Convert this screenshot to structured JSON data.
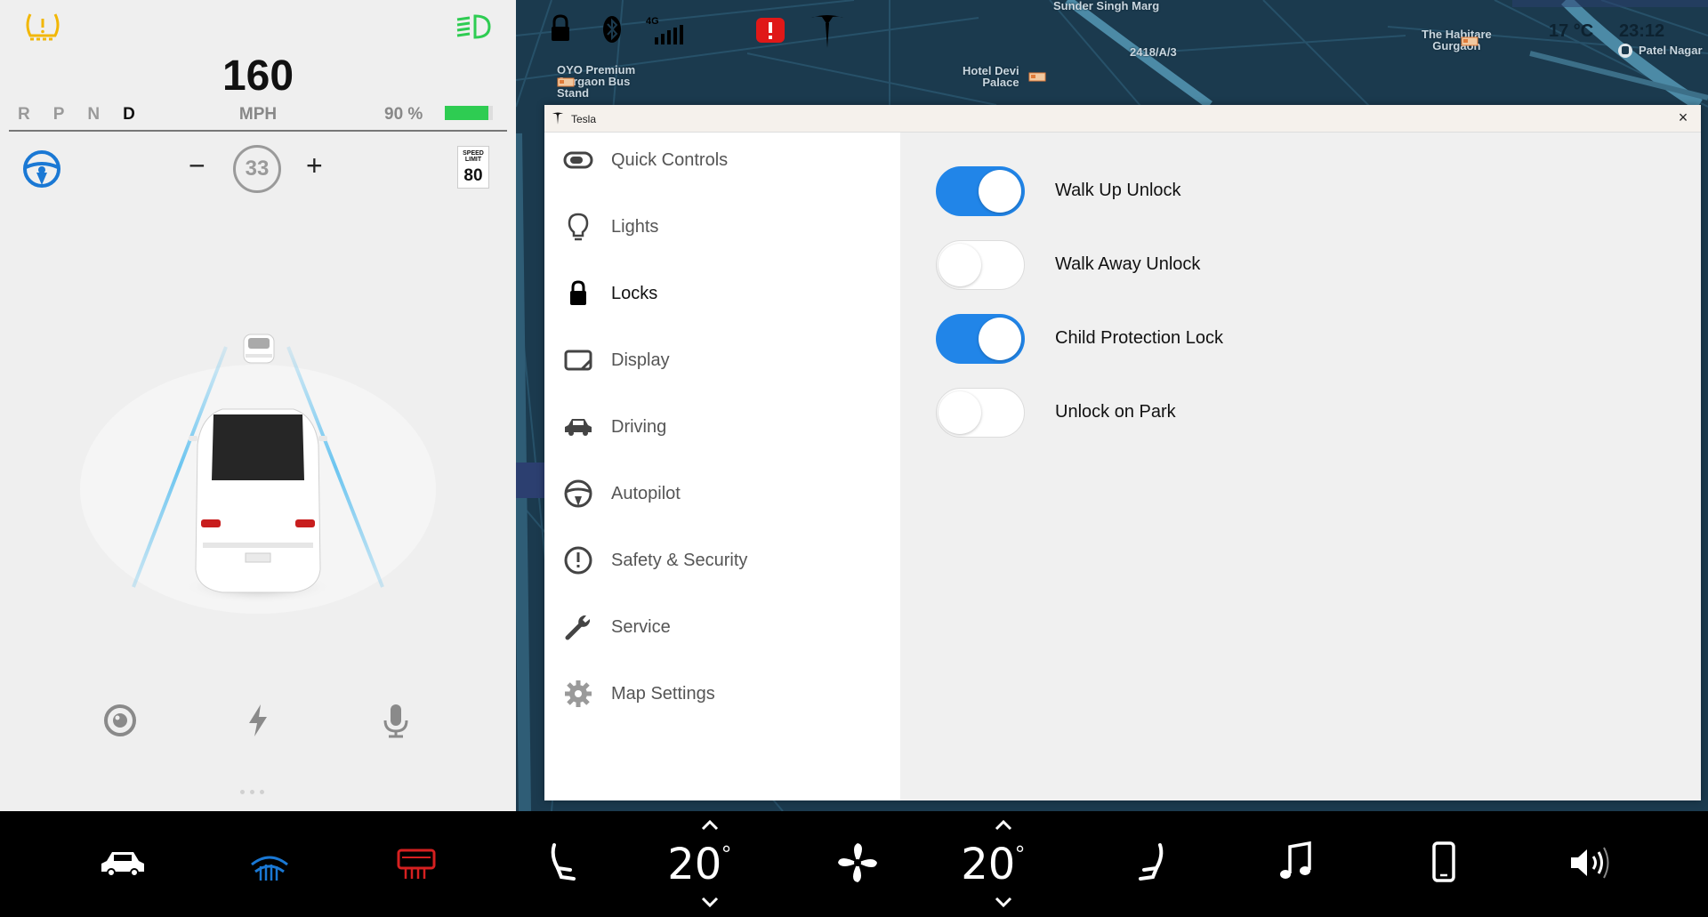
{
  "driver_panel": {
    "speed": "160",
    "speed_unit": "MPH",
    "gears": [
      "R",
      "P",
      "N",
      "D"
    ],
    "active_gear": "D",
    "battery_percent_label": "90 %",
    "battery_level": 0.9,
    "cruise_minus": "−",
    "cruise_speed": "33",
    "cruise_plus": "+",
    "speed_limit_title": "SPEED LIMIT",
    "speed_limit_value": "80",
    "bottom_icons": [
      "camera-icon",
      "bolt-icon",
      "microphone-icon"
    ],
    "colors": {
      "warning": "#f2b705",
      "headlight": "#2ecc52",
      "steering": "#1a78d4",
      "battery": "#2ecc52"
    }
  },
  "map": {
    "labels": {
      "sunder_singh_marg": "Sunder Singh Marg",
      "plot_2418": "2418/A/3",
      "habitare_1": "The Habitare",
      "habitare_2": "Gurgaon",
      "oyo_1": "OYO Premium",
      "oyo_2": "Gurgaon Bus",
      "oyo_3": "Stand",
      "devi_1": "Hotel Devi",
      "devi_2": "Palace",
      "patel_nagar": "Patel Nagar"
    },
    "temperature": "17 °C",
    "time": "23:12",
    "status_icons": [
      "lock-icon",
      "bluetooth-icon",
      "signal-4g-icon",
      "alert-icon",
      "tesla-logo-icon"
    ],
    "network_label": "4G"
  },
  "settings_window": {
    "title": "Tesla",
    "close_label": "×",
    "nav_items": [
      {
        "label": "Quick Controls",
        "icon": "toggle-icon"
      },
      {
        "label": "Lights",
        "icon": "bulb-icon"
      },
      {
        "label": "Locks",
        "icon": "lock-icon"
      },
      {
        "label": "Display",
        "icon": "display-icon"
      },
      {
        "label": "Driving",
        "icon": "car-icon"
      },
      {
        "label": "Autopilot",
        "icon": "steering-wheel-icon"
      },
      {
        "label": "Safety & Security",
        "icon": "alert-circle-icon"
      },
      {
        "label": "Service",
        "icon": "wrench-icon"
      },
      {
        "label": "Map Settings",
        "icon": "gear-icon"
      }
    ],
    "active_nav": "Locks",
    "toggles": [
      {
        "label": "Walk Up Unlock",
        "on": true
      },
      {
        "label": "Walk Away Unlock",
        "on": false
      },
      {
        "label": "Child Protection Lock",
        "on": true
      },
      {
        "label": "Unlock on Park",
        "on": false
      }
    ],
    "colors": {
      "toggle_on": "#2185e8"
    }
  },
  "bottom_bar": {
    "icons": [
      "car-icon",
      "front-defrost-icon",
      "rear-defrost-icon",
      "seat-heater-left-icon",
      "fan-icon",
      "seat-heater-right-icon",
      "music-icon",
      "phone-icon",
      "volume-icon"
    ],
    "driver_temp": "20",
    "passenger_temp": "20",
    "colors": {
      "front_defrost": "#1a78d4",
      "rear_defrost": "#d62020"
    }
  }
}
